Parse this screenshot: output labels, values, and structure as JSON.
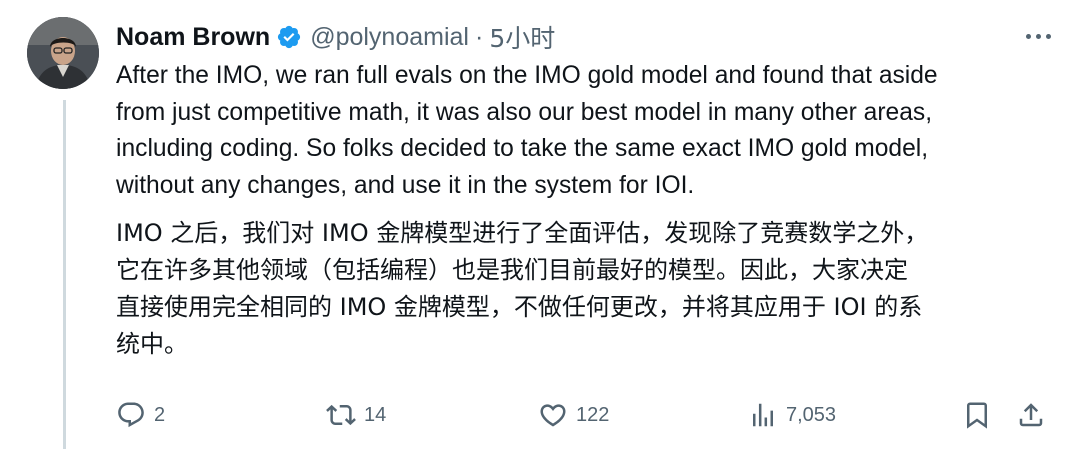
{
  "tweet": {
    "author_name": "Noam Brown",
    "handle": "@polynoamial",
    "separator": "·",
    "time": "5小时",
    "text_en_lines": [
      "After the IMO, we ran full evals on the IMO gold model and found that aside",
      "from just competitive math, it was also our best model in many other areas,",
      "including coding. So folks decided to take the same exact IMO gold model,",
      "without any changes, and use it in the system for IOI."
    ],
    "text_zh_lines": [
      "IMO 之后，我们对 IMO 金牌模型进行了全面评估，发现除了竞赛数学之外，",
      "它在许多其他领域（包括编程）也是我们目前最好的模型。因此，大家决定",
      "直接使用完全相同的 IMO 金牌模型，不做任何更改，并将其应用于 IOI 的系",
      "统中。"
    ]
  },
  "actions": {
    "reply_count": "2",
    "retweet_count": "14",
    "like_count": "122",
    "view_count": "7,053"
  },
  "icons": {
    "verified": "verified-badge-icon",
    "more": "more-options-icon",
    "reply": "reply-icon",
    "retweet": "retweet-icon",
    "like": "heart-icon",
    "views": "views-icon",
    "bookmark": "bookmark-icon",
    "share": "share-icon"
  },
  "colors": {
    "text": "#0f1419",
    "secondary": "#536471",
    "verified": "#1d9bf0",
    "thread_line": "#cfd9de"
  }
}
